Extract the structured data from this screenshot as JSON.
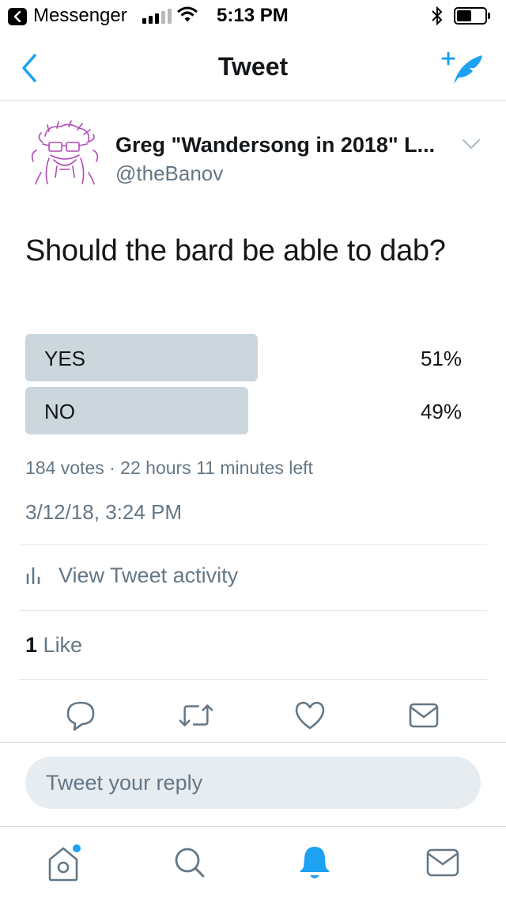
{
  "status_bar": {
    "back_app": "Messenger",
    "time": "5:13 PM",
    "icons": [
      "back-arrow-icon",
      "signal-icon",
      "wifi-icon",
      "bluetooth-icon",
      "battery-icon"
    ]
  },
  "nav": {
    "title": "Tweet",
    "icons": [
      "chevron-left-icon",
      "compose-tweet-icon"
    ]
  },
  "tweet": {
    "author_name": "Greg \"Wandersong in 2018\" L...",
    "author_handle": "@theBanov",
    "text": "Should the bard be able to dab?",
    "poll": {
      "options": [
        {
          "label": "YES",
          "percent_text": "51%",
          "percent": 51
        },
        {
          "label": "NO",
          "percent_text": "49%",
          "percent": 49
        }
      ],
      "meta": "184 votes · 22 hours 11 minutes left"
    },
    "timestamp": "3/12/18, 3:24 PM",
    "activity_label": "View Tweet activity",
    "like_count": "1",
    "like_label": "Like",
    "action_icons": [
      "reply-icon",
      "retweet-icon",
      "like-heart-icon",
      "share-mail-icon"
    ]
  },
  "reply": {
    "placeholder": "Tweet your reply"
  },
  "tab_bar": {
    "icons": [
      "home-icon",
      "search-icon",
      "notifications-bell-icon",
      "messages-mail-icon"
    ]
  },
  "colors": {
    "accent": "#1da1f2",
    "text_primary": "#14171a",
    "text_secondary": "#657786",
    "poll_bar": "#ccd6dd",
    "reply_bg": "#e6ecf0",
    "divider": "#e1e8ed"
  }
}
